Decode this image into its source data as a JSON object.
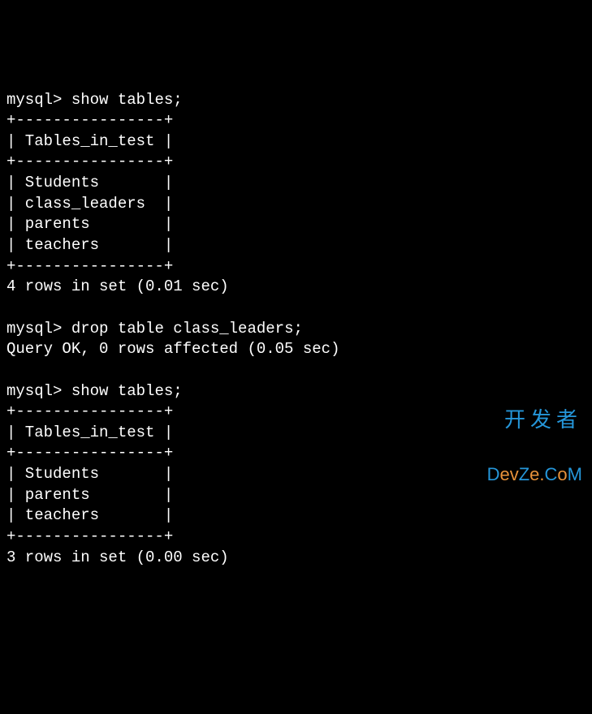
{
  "terminal": {
    "prompt": "mysql>",
    "block1": {
      "command": "show tables;",
      "border_top": "+----------------+",
      "header_row": "| Tables_in_test |",
      "border_mid": "+----------------+",
      "rows": [
        "| Students       |",
        "| class_leaders  |",
        "| parents        |",
        "| teachers       |"
      ],
      "border_bottom": "+----------------+",
      "summary": "4 rows in set (0.01 sec)"
    },
    "block2": {
      "command": "drop table class_leaders;",
      "result": "Query OK, 0 rows affected (0.05 sec)"
    },
    "block3": {
      "command": "show tables;",
      "border_top": "+----------------+",
      "header_row": "| Tables_in_test |",
      "border_mid": "+----------------+",
      "rows": [
        "| Students       |",
        "| parents        |",
        "| teachers       |"
      ],
      "border_bottom": "+----------------+",
      "summary": "3 rows in set (0.00 sec)"
    }
  },
  "watermark": {
    "line1": "开发者",
    "line2": "DevZe.CoM"
  }
}
